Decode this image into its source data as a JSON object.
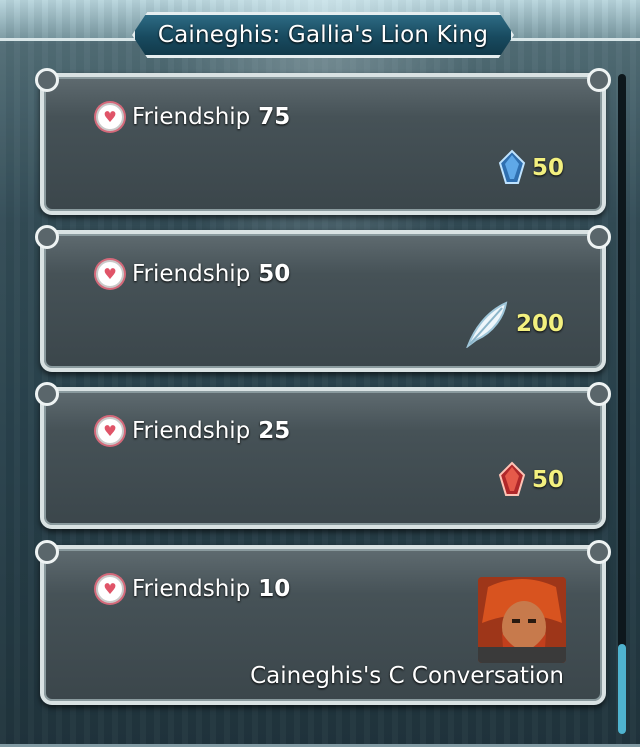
{
  "header": {
    "title": "Caineghis: Gallia's Lion King"
  },
  "rewards": [
    {
      "label": "Friendship",
      "level": "75",
      "icon": "blue-orb-icon",
      "amount": "50"
    },
    {
      "label": "Friendship",
      "level": "50",
      "icon": "feather-icon",
      "amount": "200"
    },
    {
      "label": "Friendship",
      "level": "25",
      "icon": "red-orb-icon",
      "amount": "50"
    },
    {
      "label": "Friendship",
      "level": "10",
      "icon": "character-portrait",
      "amount": "",
      "caption": "Caineghis's C Conversation"
    }
  ],
  "colors": {
    "amount_text": "#f3f07f",
    "scroll_thumb": "#4fb3cf",
    "title_plate": "#1f5a72"
  }
}
